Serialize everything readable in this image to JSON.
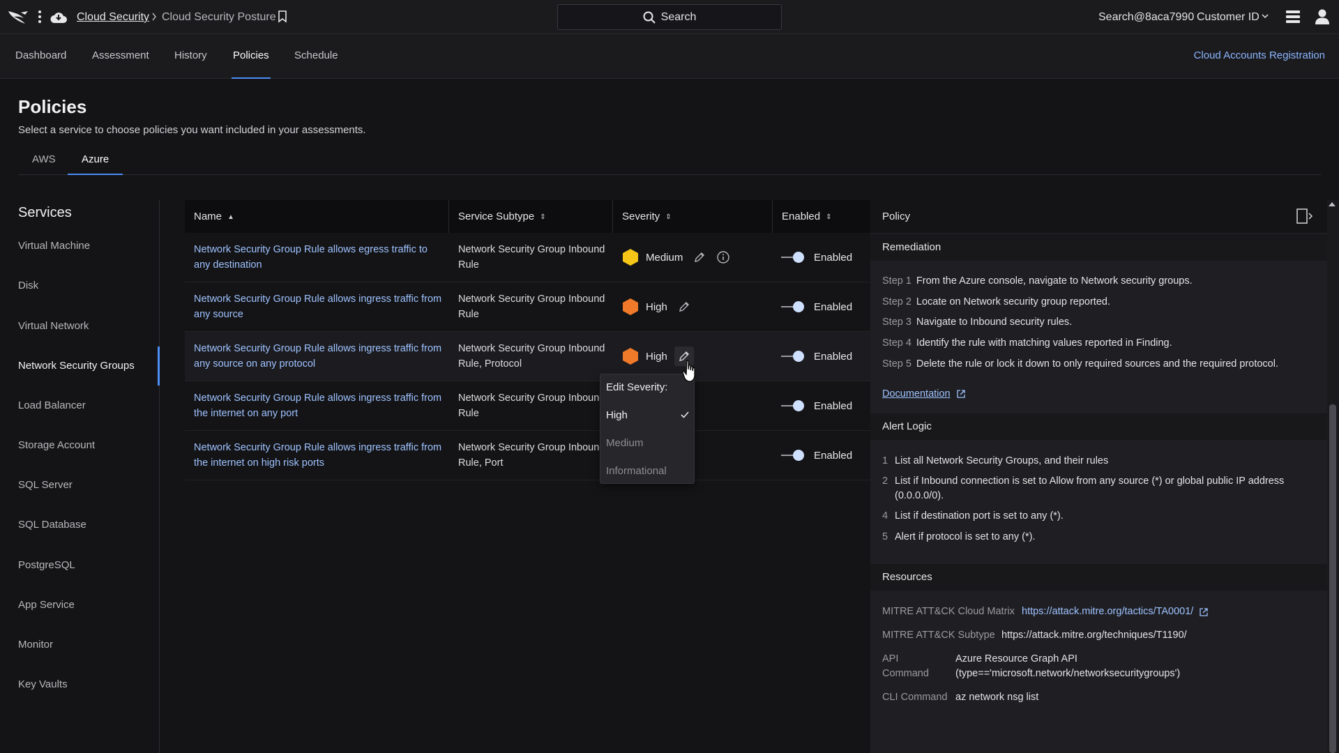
{
  "topbar": {
    "breadcrumb_root": "Cloud Security",
    "breadcrumb_current": "Cloud Security Posture",
    "search_label": "Search",
    "user": "Search@8aca7990",
    "customer_id": "Customer ID"
  },
  "nav": {
    "tabs": [
      {
        "label": "Dashboard"
      },
      {
        "label": "Assessment"
      },
      {
        "label": "History"
      },
      {
        "label": "Policies",
        "active": true
      },
      {
        "label": "Schedule"
      }
    ],
    "right_link": "Cloud Accounts Registration"
  },
  "page": {
    "title": "Policies",
    "subtitle": "Select a service to choose policies you want included in your assessments.",
    "cloud_tabs": [
      {
        "label": "AWS"
      },
      {
        "label": "Azure",
        "active": true
      }
    ]
  },
  "sidebar": {
    "title": "Services",
    "items": [
      {
        "label": "Virtual Machine"
      },
      {
        "label": "Disk"
      },
      {
        "label": "Virtual Network"
      },
      {
        "label": "Network Security Groups",
        "active": true
      },
      {
        "label": "Load Balancer"
      },
      {
        "label": "Storage Account"
      },
      {
        "label": "SQL Server"
      },
      {
        "label": "SQL Database"
      },
      {
        "label": "PostgreSQL"
      },
      {
        "label": "App Service"
      },
      {
        "label": "Monitor"
      },
      {
        "label": "Key Vaults"
      }
    ]
  },
  "table": {
    "headers": {
      "name": "Name",
      "subtype": "Service Subtype",
      "severity": "Severity",
      "enabled": "Enabled"
    },
    "rows": [
      {
        "name": "Network Security Group Rule allows egress traffic to any destination",
        "subtype": "Network Security Group Inbound Rule",
        "severity": "Medium",
        "severity_color": "#f5c518",
        "enabled": "Enabled"
      },
      {
        "name": "Network Security Group Rule allows ingress traffic from any source",
        "subtype": "Network Security Group Inbound Rule",
        "severity": "High",
        "severity_color": "#f07a2a",
        "enabled": "Enabled"
      },
      {
        "name": "Network Security Group Rule allows ingress traffic from any source on any protocol",
        "subtype": "Network Security Group Inbound Rule, Protocol",
        "severity": "High",
        "severity_color": "#f07a2a",
        "enabled": "Enabled"
      },
      {
        "name": "Network Security Group Rule allows ingress traffic from the internet on any port",
        "subtype": "Network Security Group Inbound Rule",
        "severity": "",
        "severity_color": "",
        "enabled": "Enabled"
      },
      {
        "name": "Network Security Group Rule allows ingress traffic from the internet on high risk ports",
        "subtype": "Network Security Group Inbound Rule, Port",
        "severity": "",
        "severity_color": "",
        "enabled": "Enabled"
      }
    ]
  },
  "severity_dropdown": {
    "title": "Edit Severity:",
    "options": [
      {
        "label": "High",
        "selected": true
      },
      {
        "label": "Medium"
      },
      {
        "label": "Informational"
      }
    ]
  },
  "panel": {
    "title": "Policy",
    "remediation_title": "Remediation",
    "steps": [
      {
        "n": "Step 1",
        "text": "From the Azure console, navigate to Network security groups."
      },
      {
        "n": "Step 2",
        "text": "Locate on Network security group reported."
      },
      {
        "n": "Step 3",
        "text": "Navigate to Inbound security rules."
      },
      {
        "n": "Step 4",
        "text": "Identify the rule with matching values reported in Finding."
      },
      {
        "n": "Step 5",
        "text": "Delete the rule or lock it down to only required sources and the required protocol."
      }
    ],
    "documentation_link": "Documentation",
    "alert_logic_title": "Alert Logic",
    "alert_logic": [
      {
        "n": "1",
        "text": "List all Network Security Groups, and their rules"
      },
      {
        "n": "2",
        "text": "List if Inbound connection is set to Allow from any source (*) or global public IP address (0.0.0.0/0)."
      },
      {
        "n": "4",
        "text": "List if destination port is set to any (*)."
      },
      {
        "n": "5",
        "text": "Alert if protocol is set to any (*)."
      }
    ],
    "resources_title": "Resources",
    "resources": {
      "cloud_matrix_label": "MITRE ATT&CK Cloud Matrix",
      "cloud_matrix_value": "https://attack.mitre.org/tactics/TA0001/",
      "subtype_label": "MITRE ATT&CK Subtype",
      "subtype_value": "https://attack.mitre.org/techniques/T1190/",
      "api_label_1": "API",
      "api_label_2": "Command",
      "api_value_1": "Azure Resource Graph API",
      "api_value_2": "(type=='microsoft.network/networksecuritygroups')",
      "cli_label": "CLI Command",
      "cli_value": "az network nsg list"
    }
  },
  "colors": {
    "accent": "#4c8df6",
    "link": "#9ec2ff",
    "high": "#f07a2a",
    "medium": "#f5c518"
  }
}
